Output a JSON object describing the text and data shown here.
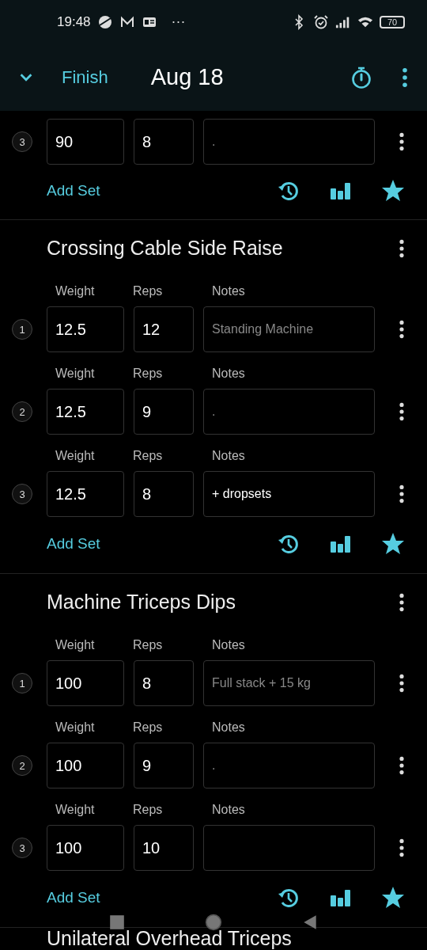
{
  "status_bar": {
    "time": "19:48",
    "overflow": "···",
    "battery": "70"
  },
  "app_bar": {
    "finish": "Finish",
    "title": "Aug 18"
  },
  "exercises": [
    {
      "sets": [
        {
          "number": "3",
          "weight": "90",
          "reps": "8",
          "notes_placeholder": "."
        }
      ],
      "add_set": "Add Set"
    },
    {
      "name": "Crossing Cable Side Raise",
      "sets": [
        {
          "number": "1",
          "weight_label": "Weight",
          "weight": "12.5",
          "reps_label": "Reps",
          "reps": "12",
          "notes_label": "Notes",
          "notes_placeholder": "Standing Machine"
        },
        {
          "number": "2",
          "weight_label": "Weight",
          "weight": "12.5",
          "reps_label": "Reps",
          "reps": "9",
          "notes_label": "Notes",
          "notes_placeholder": "."
        },
        {
          "number": "3",
          "weight_label": "Weight",
          "weight": "12.5",
          "reps_label": "Reps",
          "reps": "8",
          "notes_label": "Notes",
          "notes": "+ dropsets"
        }
      ],
      "add_set": "Add Set"
    },
    {
      "name": "Machine Triceps Dips",
      "sets": [
        {
          "number": "1",
          "weight_label": "Weight",
          "weight": "100",
          "reps_label": "Reps",
          "reps": "8",
          "notes_label": "Notes",
          "notes_placeholder": "Full stack + 15 kg"
        },
        {
          "number": "2",
          "weight_label": "Weight",
          "weight": "100",
          "reps_label": "Reps",
          "reps": "9",
          "notes_label": "Notes",
          "notes_placeholder": "."
        },
        {
          "number": "3",
          "weight_label": "Weight",
          "weight": "100",
          "reps_label": "Reps",
          "reps": "10",
          "notes_label": "Notes"
        }
      ],
      "add_set": "Add Set"
    },
    {
      "name": "Unilateral Overhead Triceps"
    }
  ]
}
